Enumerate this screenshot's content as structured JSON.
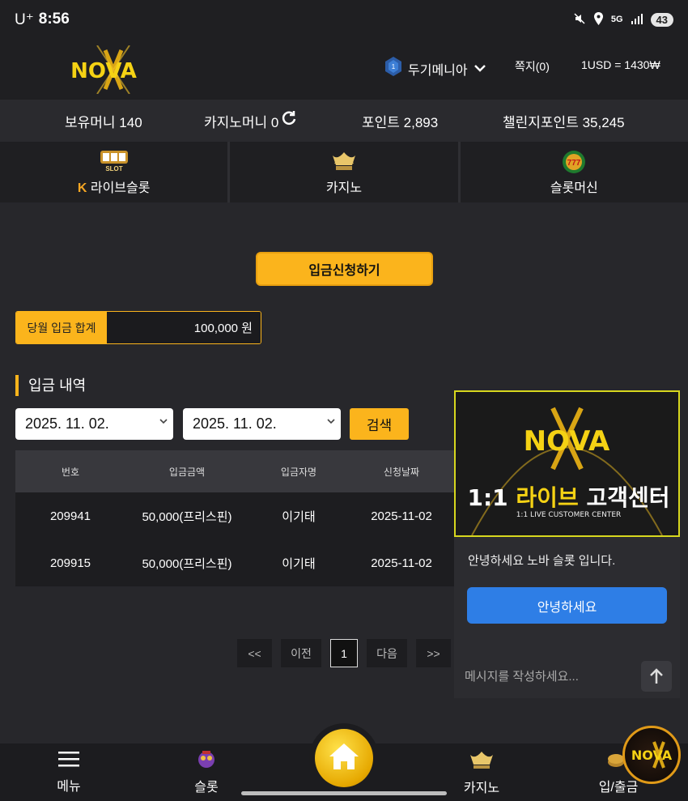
{
  "statusbar": {
    "carrier": "U⁺",
    "time": "8:56",
    "network": "5G",
    "battery": "43"
  },
  "header": {
    "logo": "NOVA",
    "username": "두기메니아",
    "messages": "쪽지(0)",
    "rate": "1USD = 1430₩"
  },
  "balances": {
    "money": "보유머니 140",
    "casino_money": "카지노머니 0",
    "points": "포인트 2,893",
    "challenge_points": "챌린지포인트 35,245"
  },
  "categories": [
    {
      "label": "라이브슬롯",
      "icon": "live-slot-icon",
      "icon_text": "SLOT"
    },
    {
      "label": "카지노",
      "icon": "casino-crown-icon"
    },
    {
      "label": "슬롯머신",
      "icon": "slot-machine-icon"
    }
  ],
  "main": {
    "apply_button": "입금신청하기",
    "monthly_label": "당월 입금 합계",
    "monthly_value": "100,000 원",
    "section_title": "입금 내역",
    "date_from": "2025. 11. 02.",
    "date_to": "2025. 11. 02.",
    "search_button": "검색"
  },
  "table": {
    "headers": [
      "번호",
      "입금금액",
      "입금자명",
      "신청날짜"
    ],
    "rows": [
      [
        "209941",
        "50,000(프리스핀)",
        "이기태",
        "2025-11-02"
      ],
      [
        "209915",
        "50,000(프리스핀)",
        "이기태",
        "2025-11-02"
      ]
    ]
  },
  "pagination": {
    "first": "<<",
    "prev": "이전",
    "current": "1",
    "next": "다음",
    "last": ">>"
  },
  "chat": {
    "banner_logo": "NOVA",
    "banner_title_num": "1:1",
    "banner_title_a": "라이브",
    "banner_title_b": "고객센터",
    "banner_sub": "1:1 LIVE CUSTOMER CENTER",
    "greeting": "안녕하세요 노바 슬롯 입니다.",
    "button": "안녕하세요",
    "placeholder": "메시지를 작성하세요..."
  },
  "bottom_nav": {
    "menu": "메뉴",
    "slot": "슬롯",
    "casino": "카지노",
    "deposit": "입/출금",
    "badge_logo": "NOVA"
  },
  "colors": {
    "accent": "#fbb41c",
    "chat_button": "#2e7ee6",
    "background": "#27272b"
  }
}
